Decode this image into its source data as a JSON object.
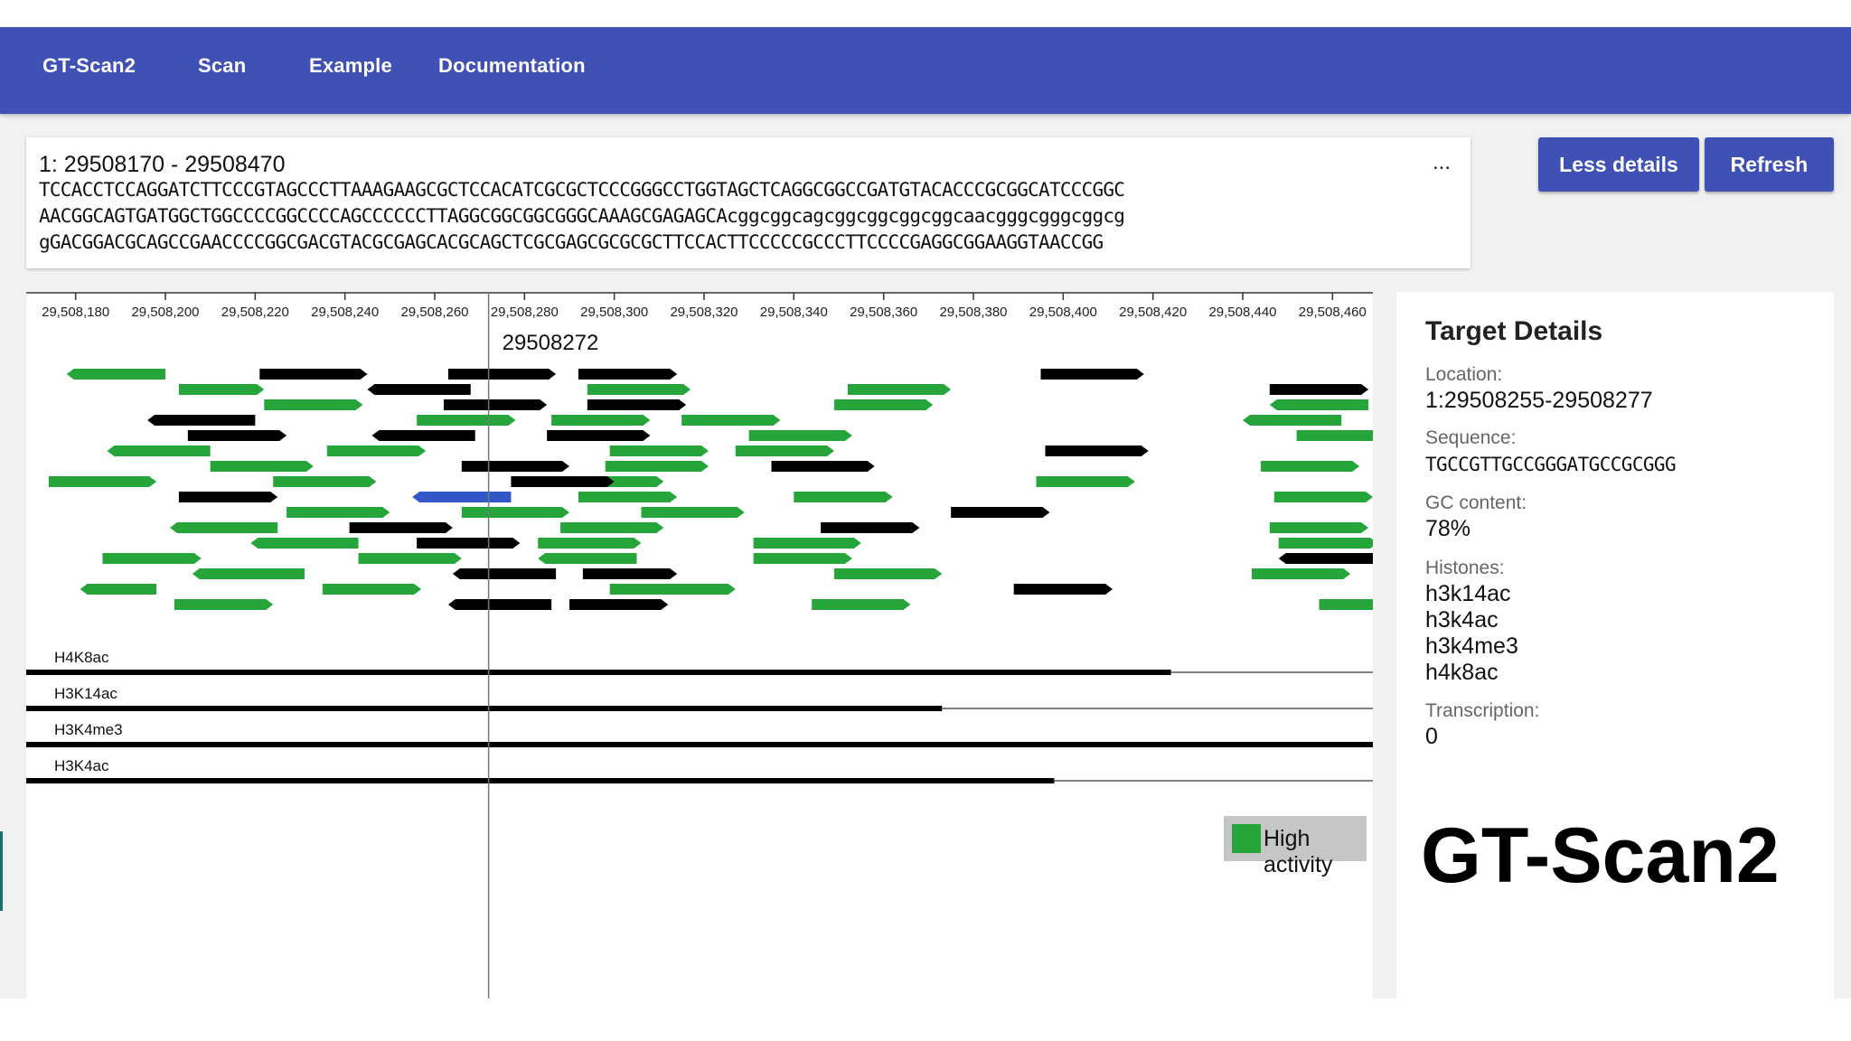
{
  "nav": {
    "items": [
      {
        "label": "GT-Scan2"
      },
      {
        "label": "Scan"
      },
      {
        "label": "Example"
      },
      {
        "label": "Documentation"
      }
    ]
  },
  "sequence": {
    "header": "1: 29508170 - 29508470",
    "more": "...",
    "lines": [
      "TCCACCTCCAGGATCTTCCCGTAGCCCTTAAAGAAGCGCTCCACATCGCGCTCCCGGGCCTGGTAGCTCAGGCGGCCGATGTACACCCGCGGCATCCCGGC",
      "AACGGCAGTGATGGCTGGCCCCGGCCCCAGCCCCCCTTAGGCGGCGGCGGGCAAAGCGAGAGCAcggcggcagcggcggcggcggcaacgggcgggcggcg",
      "gGACGGACGCAGCCGAACCCCGGCGACGTACGCGAGCACGCAGCTCGCGAGCGCGCGCTTCCACTTCCCCCGCCCTTCCCCGAGGCGGAAGGTAACCGG"
    ]
  },
  "buttons": {
    "less_details": "Less details",
    "refresh": "Refresh"
  },
  "ruler": {
    "ticks": [
      "29,508,180",
      "29,508,200",
      "29,508,220",
      "29,508,240",
      "29,508,260",
      "29,508,280",
      "29,508,300",
      "29,508,320",
      "29,508,340",
      "29,508,360",
      "29,508,380",
      "29,508,400",
      "29,508,420",
      "29,508,440",
      "29,508,460"
    ],
    "cursor_position": "29508272"
  },
  "colors": {
    "high_activity": "#26a53a",
    "low_activity": "#000000",
    "selected": "#3357c7",
    "primary": "#3f51b5"
  },
  "targets": [
    {
      "start": 29508178,
      "end": 29508200,
      "dir": "L",
      "level": 0
    },
    {
      "start": 29508174,
      "end": 29508198,
      "dir": "R",
      "level": 0
    },
    {
      "start": 29508181,
      "end": 29508198,
      "dir": "L",
      "level": 0
    },
    {
      "start": 29508187,
      "end": 29508210,
      "dir": "L",
      "level": 0
    },
    {
      "start": 29508186,
      "end": 29508208,
      "dir": "R",
      "level": 0
    },
    {
      "start": 29508196,
      "end": 29508220,
      "dir": "L",
      "level": 1
    },
    {
      "start": 29508201,
      "end": 29508225,
      "dir": "L",
      "level": 0
    },
    {
      "start": 29508203,
      "end": 29508222,
      "dir": "R",
      "level": 0
    },
    {
      "start": 29508203,
      "end": 29508225,
      "dir": "R",
      "level": 1
    },
    {
      "start": 29508202,
      "end": 29508224,
      "dir": "R",
      "level": 0
    },
    {
      "start": 29508210,
      "end": 29508233,
      "dir": "R",
      "level": 0
    },
    {
      "start": 29508206,
      "end": 29508231,
      "dir": "L",
      "level": 0
    },
    {
      "start": 29508205,
      "end": 29508227,
      "dir": "R",
      "level": 1
    },
    {
      "start": 29508219,
      "end": 29508243,
      "dir": "L",
      "level": 0
    },
    {
      "start": 29508222,
      "end": 29508244,
      "dir": "R",
      "level": 0
    },
    {
      "start": 29508227,
      "end": 29508250,
      "dir": "R",
      "level": 0
    },
    {
      "start": 29508221,
      "end": 29508245,
      "dir": "R",
      "level": 1
    },
    {
      "start": 29508224,
      "end": 29508247,
      "dir": "R",
      "level": 0
    },
    {
      "start": 29508235,
      "end": 29508257,
      "dir": "R",
      "level": 0
    },
    {
      "start": 29508236,
      "end": 29508258,
      "dir": "R",
      "level": 0
    },
    {
      "start": 29508243,
      "end": 29508266,
      "dir": "R",
      "level": 0
    },
    {
      "start": 29508256,
      "end": 29508278,
      "dir": "R",
      "level": 0
    },
    {
      "start": 29508241,
      "end": 29508264,
      "dir": "R",
      "level": 1
    },
    {
      "start": 29508245,
      "end": 29508268,
      "dir": "L",
      "level": 1
    },
    {
      "start": 29508255,
      "end": 29508277,
      "dir": "L",
      "level": 2
    },
    {
      "start": 29508263,
      "end": 29508286,
      "dir": "L",
      "level": 1
    },
    {
      "start": 29508266,
      "end": 29508290,
      "dir": "R",
      "level": 1
    },
    {
      "start": 29508264,
      "end": 29508287,
      "dir": "L",
      "level": 1
    },
    {
      "start": 29508246,
      "end": 29508269,
      "dir": "L",
      "level": 1
    },
    {
      "start": 29508256,
      "end": 29508279,
      "dir": "R",
      "level": 1
    },
    {
      "start": 29508262,
      "end": 29508285,
      "dir": "R",
      "level": 1
    },
    {
      "start": 29508266,
      "end": 29508290,
      "dir": "R",
      "level": 0
    },
    {
      "start": 29508263,
      "end": 29508287,
      "dir": "R",
      "level": 1
    },
    {
      "start": 29508287,
      "end": 29508311,
      "dir": "R",
      "level": 0
    },
    {
      "start": 29508303,
      "end": 29508327,
      "dir": "R",
      "level": 0
    },
    {
      "start": 29508299,
      "end": 29508321,
      "dir": "R",
      "level": 0
    },
    {
      "start": 29508283,
      "end": 29508305,
      "dir": "L",
      "level": 0
    },
    {
      "start": 29508286,
      "end": 29508308,
      "dir": "R",
      "level": 0
    },
    {
      "start": 29508288,
      "end": 29508311,
      "dir": "R",
      "level": 0
    },
    {
      "start": 29508294,
      "end": 29508317,
      "dir": "R",
      "level": 0
    },
    {
      "start": 29508292,
      "end": 29508314,
      "dir": "R",
      "level": 0
    },
    {
      "start": 29508290,
      "end": 29508312,
      "dir": "R",
      "level": 1
    },
    {
      "start": 29508298,
      "end": 29508321,
      "dir": "R",
      "level": 0
    },
    {
      "start": 29508285,
      "end": 29508308,
      "dir": "R",
      "level": 1
    },
    {
      "start": 29508306,
      "end": 29508329,
      "dir": "R",
      "level": 0
    },
    {
      "start": 29508283,
      "end": 29508306,
      "dir": "R",
      "level": 0
    },
    {
      "start": 29508294,
      "end": 29508316,
      "dir": "R",
      "level": 1
    },
    {
      "start": 29508293,
      "end": 29508314,
      "dir": "R",
      "level": 1
    },
    {
      "start": 29508292,
      "end": 29508314,
      "dir": "R",
      "level": 1
    },
    {
      "start": 29508277,
      "end": 29508300,
      "dir": "R",
      "level": 1
    },
    {
      "start": 29508299,
      "end": 29508321,
      "dir": "R",
      "level": 0
    },
    {
      "start": 29508327,
      "end": 29508349,
      "dir": "R",
      "level": 0
    },
    {
      "start": 29508331,
      "end": 29508353,
      "dir": "R",
      "level": 0
    },
    {
      "start": 29508315,
      "end": 29508337,
      "dir": "R",
      "level": 0
    },
    {
      "start": 29508346,
      "end": 29508368,
      "dir": "R",
      "level": 1
    },
    {
      "start": 29508352,
      "end": 29508375,
      "dir": "R",
      "level": 0
    },
    {
      "start": 29508340,
      "end": 29508362,
      "dir": "R",
      "level": 0
    },
    {
      "start": 29508344,
      "end": 29508366,
      "dir": "R",
      "level": 0
    },
    {
      "start": 29508335,
      "end": 29508358,
      "dir": "R",
      "level": 1
    },
    {
      "start": 29508349,
      "end": 29508373,
      "dir": "R",
      "level": 0
    },
    {
      "start": 29508330,
      "end": 29508353,
      "dir": "R",
      "level": 0
    },
    {
      "start": 29508331,
      "end": 29508355,
      "dir": "R",
      "level": 0
    },
    {
      "start": 29508349,
      "end": 29508371,
      "dir": "R",
      "level": 0
    },
    {
      "start": 29508375,
      "end": 29508397,
      "dir": "R",
      "level": 1
    },
    {
      "start": 29508395,
      "end": 29508418,
      "dir": "R",
      "level": 1
    },
    {
      "start": 29508394,
      "end": 29508416,
      "dir": "R",
      "level": 0
    },
    {
      "start": 29508389,
      "end": 29508411,
      "dir": "R",
      "level": 1
    },
    {
      "start": 29508396,
      "end": 29508419,
      "dir": "R",
      "level": 1
    },
    {
      "start": 29508448,
      "end": 29508470,
      "dir": "L",
      "level": 1
    },
    {
      "start": 29508440,
      "end": 29508462,
      "dir": "L",
      "level": 0
    },
    {
      "start": 29508446,
      "end": 29508468,
      "dir": "R",
      "level": 0
    },
    {
      "start": 29508446,
      "end": 29508468,
      "dir": "R",
      "level": 1
    },
    {
      "start": 29508447,
      "end": 29508469,
      "dir": "R",
      "level": 0
    },
    {
      "start": 29508457,
      "end": 29508479,
      "dir": "R",
      "level": 0
    },
    {
      "start": 29508444,
      "end": 29508466,
      "dir": "R",
      "level": 0
    },
    {
      "start": 29508442,
      "end": 29508464,
      "dir": "R",
      "level": 0
    },
    {
      "start": 29508452,
      "end": 29508474,
      "dir": "R",
      "level": 0
    },
    {
      "start": 29508448,
      "end": 29508470,
      "dir": "R",
      "level": 0
    },
    {
      "start": 29508446,
      "end": 29508468,
      "dir": "L",
      "level": 0
    }
  ],
  "legend": {
    "label": "High activity"
  },
  "histone_tracks": [
    {
      "label": "H4K8ac",
      "end": 29508424
    },
    {
      "label": "H3K14ac",
      "end": 29508373
    },
    {
      "label": "H3K4me3",
      "end": 29508470
    },
    {
      "label": "H3K4ac",
      "end": 29508398
    }
  ],
  "target_details": {
    "title": "Target Details",
    "location_label": "Location:",
    "location": "1:29508255-29508277",
    "sequence_label": "Sequence:",
    "sequence": "TGCCGTTGCCGGGATGCCGCGGG",
    "gc_label": "GC content:",
    "gc": "78%",
    "histones_label": "Histones:",
    "histones": [
      "h3k14ac",
      "h3k4ac",
      "h3k4me3",
      "h4k8ac"
    ],
    "transcription_label": "Transcription:",
    "transcription": "0"
  },
  "branding": {
    "title": "GT-Scan2"
  }
}
